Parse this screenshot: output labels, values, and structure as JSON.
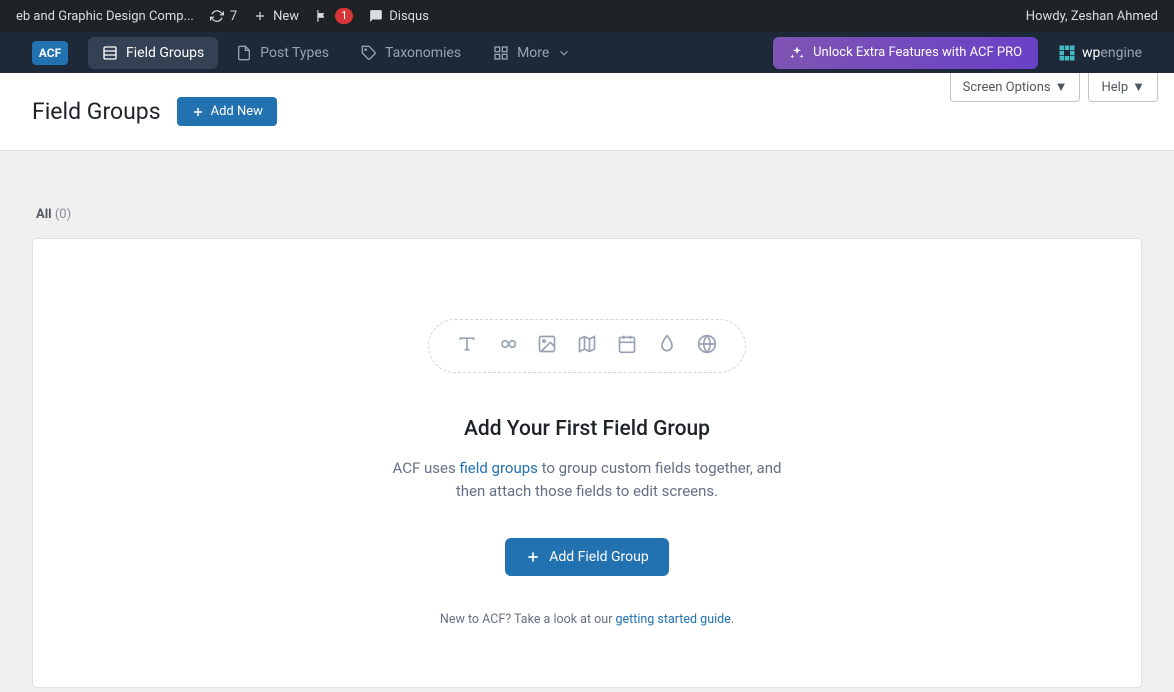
{
  "adminbar": {
    "site_title": "eb and Graphic Design Comp...",
    "updates_count": "7",
    "new_label": "New",
    "notif_count": "1",
    "disqus_label": "Disqus",
    "howdy": "Howdy, Zeshan Ahmed"
  },
  "acfbar": {
    "logo": "ACF",
    "tabs": {
      "field_groups": "Field Groups",
      "post_types": "Post Types",
      "taxonomies": "Taxonomies",
      "more": "More"
    },
    "pro_label": "Unlock Extra Features with ACF PRO",
    "wpengine_prefix": "wp",
    "wpengine_suffix": "engine"
  },
  "header": {
    "title": "Field Groups",
    "add_new": "Add New"
  },
  "screen": {
    "options": "Screen Options",
    "help": "Help"
  },
  "filters": {
    "all_label": "All",
    "all_count": "(0)"
  },
  "empty": {
    "title": "Add Your First Field Group",
    "desc_before": "ACF uses ",
    "desc_link": "field groups",
    "desc_after": " to group custom fields together, and then attach those fields to edit screens.",
    "cta": "Add Field Group",
    "help_before": "New to ACF? Take a look at our ",
    "help_link": "getting started guide",
    "help_after": "."
  }
}
